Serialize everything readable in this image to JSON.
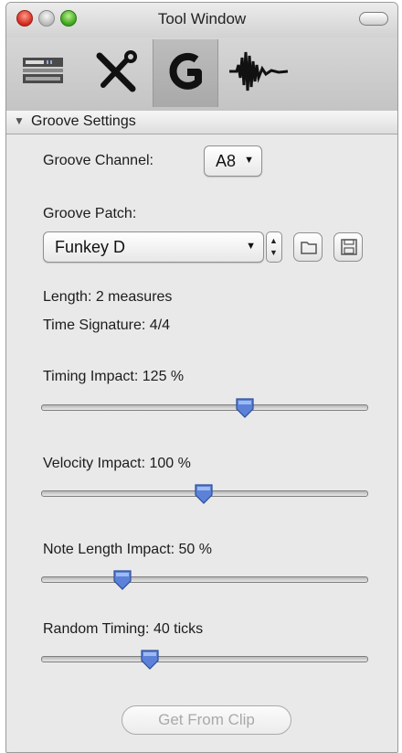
{
  "window": {
    "title": "Tool Window"
  },
  "toolbar": {
    "tools": [
      "mixer-icon",
      "tools-icon",
      "groove-icon",
      "waveform-icon"
    ],
    "selected": "groove-icon"
  },
  "section": {
    "title": "Groove Settings"
  },
  "groove_channel": {
    "label": "Groove Channel:",
    "value": "A8"
  },
  "groove_patch": {
    "label": "Groove Patch:",
    "value": "Funkey D"
  },
  "info": {
    "length": "Length: 2 measures",
    "time_signature": "Time Signature: 4/4"
  },
  "sliders": {
    "timing": {
      "label": "Timing Impact: 125 %",
      "value": 125,
      "min": 0,
      "max": 200
    },
    "velocity": {
      "label": "Velocity Impact: 100 %",
      "value": 100,
      "min": 0,
      "max": 200
    },
    "note_length": {
      "label": "Note Length Impact: 50 %",
      "value": 50,
      "min": 0,
      "max": 200
    },
    "random_timing": {
      "label": "Random Timing: 40 ticks",
      "value": 40,
      "min": 0,
      "max": 120
    }
  },
  "get_from_clip": {
    "label": "Get From Clip",
    "enabled": false
  },
  "colors": {
    "thumb": "#5b82d8",
    "selected_tool": "#b0b0b0"
  }
}
